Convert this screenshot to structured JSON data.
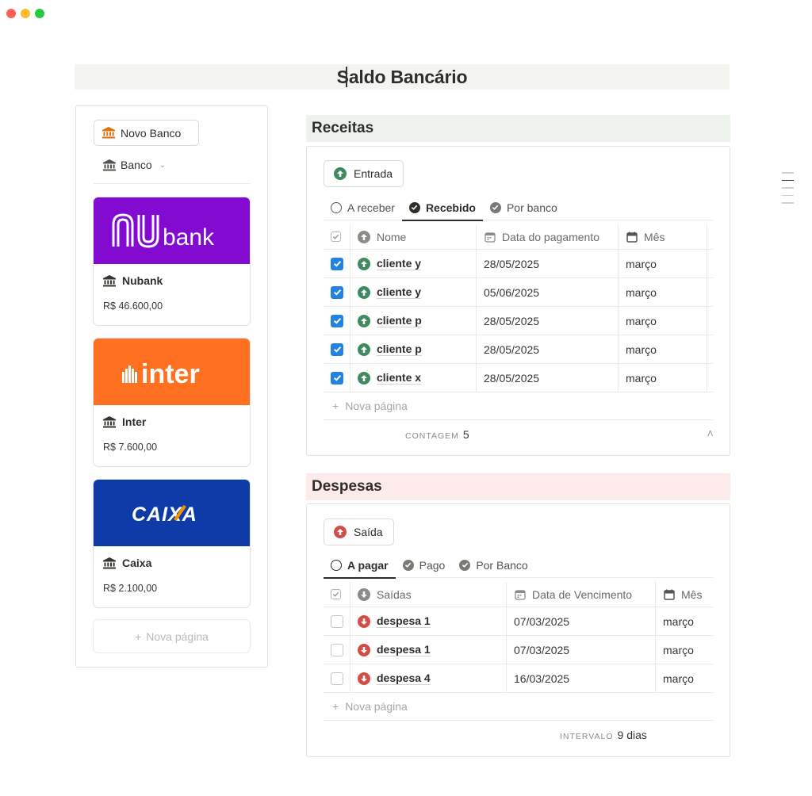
{
  "page": {
    "title": "Saldo Bancário"
  },
  "colors": {
    "nubank": "#820ad1",
    "inter": "#ff7021",
    "caixa": "#0f3ba8",
    "checkbox": "#2383e2",
    "up_green": "#3f8a5e",
    "down_red": "#d44c47"
  },
  "banks": {
    "new_button": "Novo Banco",
    "view_label": "Banco",
    "items": [
      {
        "name": "Nubank",
        "balance": "R$ 46.600,00",
        "logo_text": "bank"
      },
      {
        "name": "Inter",
        "balance": "R$ 7.600,00",
        "logo_text": "inter"
      },
      {
        "name": "Caixa",
        "balance": "R$ 2.100,00",
        "logo_text": "CAIXA"
      }
    ],
    "new_page": "Nova página"
  },
  "receitas": {
    "header": "Receitas",
    "action": "Entrada",
    "tabs": [
      "A receber",
      "Recebido",
      "Por banco"
    ],
    "active_tab": "Recebido",
    "columns": [
      "Nome",
      "Data do pagamento",
      "Mês"
    ],
    "rows": [
      {
        "checked": true,
        "name": "cliente y",
        "date": "28/05/2025",
        "month": "março"
      },
      {
        "checked": true,
        "name": "cliente y",
        "date": "05/06/2025",
        "month": "março"
      },
      {
        "checked": true,
        "name": "cliente p",
        "date": "28/05/2025",
        "month": "março"
      },
      {
        "checked": true,
        "name": "cliente p",
        "date": "28/05/2025",
        "month": "março"
      },
      {
        "checked": true,
        "name": "cliente x",
        "date": "28/05/2025",
        "month": "março"
      }
    ],
    "new_page": "Nova página",
    "footer_label": "CONTAGEM",
    "footer_value": "5"
  },
  "despesas": {
    "header": "Despesas",
    "action": "Saída",
    "tabs": [
      "A pagar",
      "Pago",
      "Por Banco"
    ],
    "active_tab": "A pagar",
    "columns": [
      "Saídas",
      "Data de Vencimento",
      "Mês"
    ],
    "rows": [
      {
        "checked": false,
        "name": "despesa 1",
        "date": "07/03/2025",
        "month": "março"
      },
      {
        "checked": false,
        "name": "despesa 1",
        "date": "07/03/2025",
        "month": "março"
      },
      {
        "checked": false,
        "name": "despesa 4",
        "date": "16/03/2025",
        "month": "março"
      }
    ],
    "new_page": "Nova página",
    "footer_label": "INTERVALO",
    "footer_value": "9 dias"
  }
}
